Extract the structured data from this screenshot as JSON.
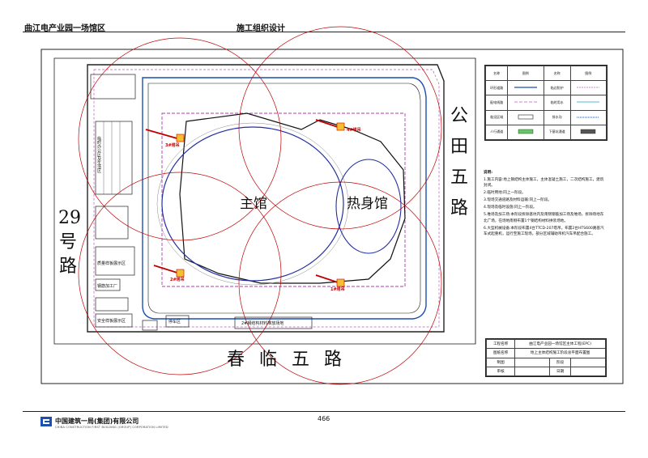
{
  "header": {
    "project": "曲江电产业园一场馆区",
    "doc_title": "施工组织设计"
  },
  "footer": {
    "page": "466",
    "company": "中国建筑一局(集团)有限公司",
    "company_en": "CHINA CONSTRUCTION FIRST BUILDING (GROUP) CORPORATION LIMITED"
  },
  "roads": {
    "west": [
      "29",
      "号",
      "路"
    ],
    "east": [
      "公",
      "田",
      "五",
      "路"
    ],
    "south": "春临五路"
  },
  "venues": {
    "main": "主馆",
    "warmup": "热身馆"
  },
  "cranes": [
    "3#塔吊",
    "4#塔吊",
    "2#塔吊",
    "1#塔吊"
  ],
  "site_labels": {
    "office": "临时办公区及生活区",
    "exhibit": "质量样板展示区",
    "safety": "安全样板展示区",
    "rebar": "钢筋加工厂",
    "steel_yard": "钢结构材料堆放场地",
    "stage_label": "2#钢结构材料堆放场地",
    "gate": "大门",
    "parking": "停车区"
  },
  "legend": {
    "headers": [
      "名称",
      "图例",
      "名称",
      "图例"
    ],
    "rows": [
      [
        "环形道路",
        "",
        "临边防护",
        ""
      ],
      [
        "配电线路",
        "",
        "临时用水",
        ""
      ],
      [
        "临设区域",
        "",
        "排水沟",
        ""
      ],
      [
        "人行通道",
        "",
        "下基坑通道",
        ""
      ]
    ]
  },
  "notes": {
    "title": "说明:",
    "items": [
      "1.施工内容:地上钢结构主体施工，主体混凝土施工，二次结构施工，建筑封闭。",
      "2.临时用地:同上一阶段。",
      "3.现场交通道路及材料运输:同上一阶段。",
      "4.现场及临时设施:同上一阶段。",
      "5.堆场及加工场:本阶段拆除基坑内及南侧钢筋加工场及堆场，拆除场地东北广场，在场地南侧布置1个钢结构材料拼装场地。",
      "6.大型机械设备:本阶段布置4台TTCD-207塔吊，布置2台HTS600路基汽车式起重机，运行至施工现场，部分区域辅助吊机汽车吊配合施工。"
    ]
  },
  "title_block": {
    "project_label": "工程名称",
    "project_value": "曲江电产业园一场馆区主体工程(EPC)",
    "drawing_label": "图纸名称",
    "drawing_value": "地上主体结构施工阶段总平面布置图",
    "drafter": "制图",
    "stage": "阶段",
    "reviewer": "审核",
    "date": "日期"
  },
  "colors": {
    "crane": "#c00000",
    "road": "#1c4fb0",
    "fence": "#b04ab0",
    "boundary": "#1a1a1a"
  }
}
